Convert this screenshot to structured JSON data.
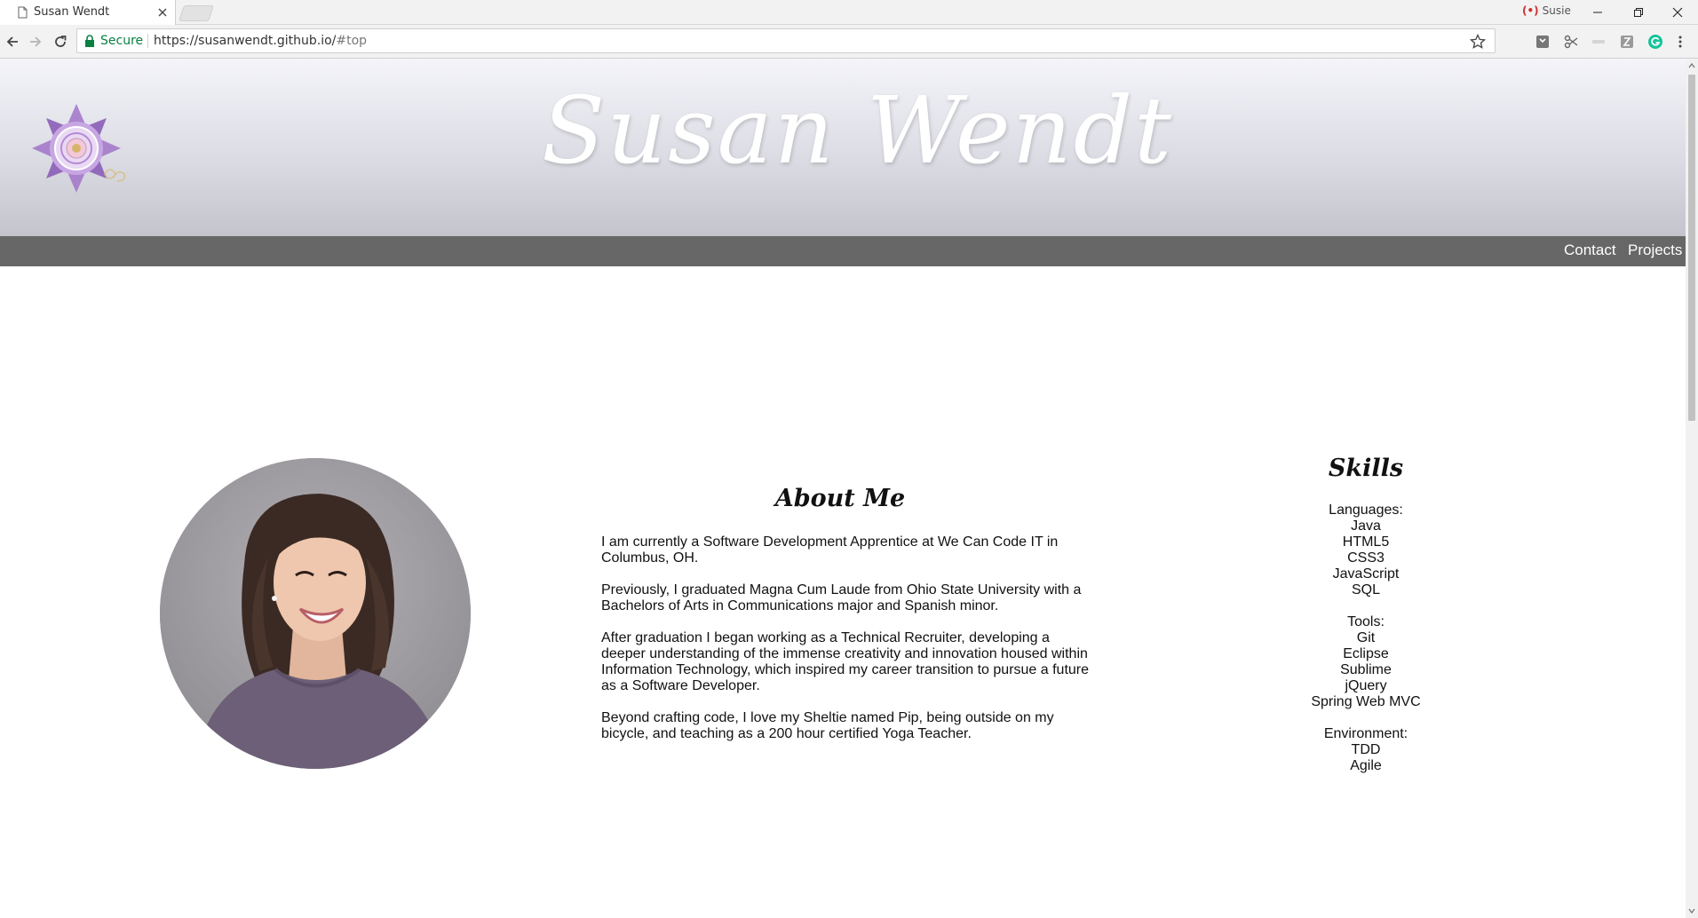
{
  "browser": {
    "tab": {
      "title": "Susan Wendt"
    },
    "profile_label": "Susie",
    "omnibox": {
      "secure_label": "Secure",
      "url_main": "https://susanwendt.github.io/",
      "url_fragment": "#top"
    },
    "extension_icons": [
      "pocket-icon",
      "scissors-icon",
      "bar-icon",
      "zotero-icon",
      "grammarly-icon"
    ]
  },
  "site": {
    "title": "Susan Wendt",
    "nav": {
      "contact": "Contact",
      "projects": "Projects"
    },
    "about": {
      "heading": "About Me",
      "paragraphs": [
        "I am currently a Software Development Apprentice at We Can Code IT in Columbus, OH.",
        "Previously, I graduated Magna Cum Laude from Ohio State University with a Bachelors of Arts in Communications major and Spanish minor.",
        "After graduation I began working as a Technical Recruiter, developing a deeper understanding of the immense creativity and innovation housed within Information Technology, which inspired my career transition to pursue a future as a Software Developer.",
        "Beyond crafting code, I love my Sheltie named Pip, being outside on my bicycle, and teaching as a 200 hour certified Yoga Teacher."
      ]
    },
    "skills": {
      "heading": "Skills",
      "groups": [
        {
          "title": "Languages:",
          "items": [
            "Java",
            "HTML5",
            "CSS3",
            "JavaScript",
            "SQL"
          ]
        },
        {
          "title": "Tools:",
          "items": [
            "Git",
            "Eclipse",
            "Sublime",
            "jQuery",
            "Spring Web MVC"
          ]
        },
        {
          "title": "Environment:",
          "items": [
            "TDD",
            "Agile"
          ]
        }
      ]
    }
  },
  "colors": {
    "navbar": "#676767",
    "header_top": "#f4f4fa",
    "header_bottom": "#c4c4cc",
    "logo_purple": "#9b6fc2",
    "secure_green": "#0b8043"
  }
}
